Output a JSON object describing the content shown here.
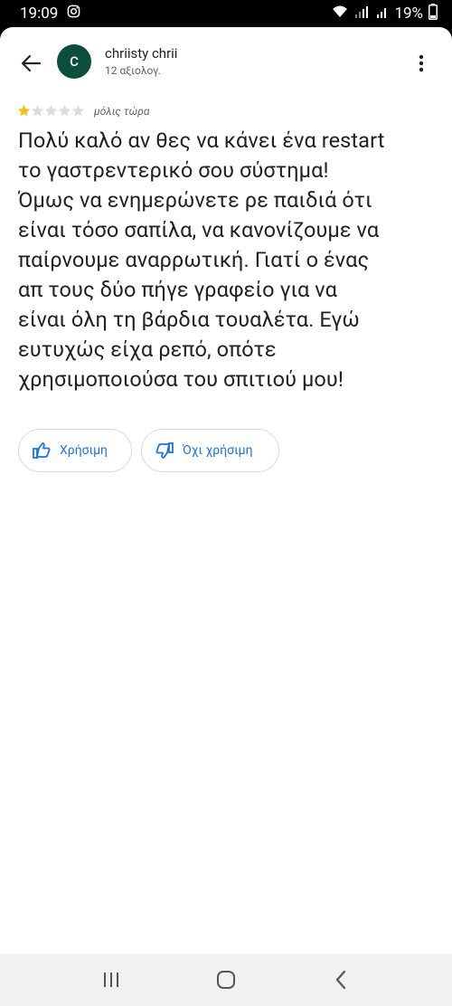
{
  "status_bar": {
    "time": "19:09",
    "battery": "19%"
  },
  "header": {
    "avatar_letter": "C",
    "user_name": "chriisty chrii",
    "user_meta": "12 αξιολογ."
  },
  "review": {
    "rating": 1,
    "max_rating": 5,
    "time": "μόλις τώρα",
    "text": "Πολύ καλό αν θες να κάνει ένα restart\nτο γαστρεντερικό σου σύστημα!\nΌμως να ενημερώνετε ρε παιδιά ότι\nείναι τόσο σαπίλα, να κανονίζουμε να\nπαίρνουμε αναρρωτική. Γιατί ο ένας\nαπ τους δύο πήγε γραφείο για να\nείναι όλη τη βάρδια τουαλέτα. Εγώ\nευτυχώς είχα ρεπό, οπότε\nχρησιμοποιούσα του σπιτιού μου!"
  },
  "actions": {
    "helpful_label": "Χρήσιμη",
    "not_helpful_label": "Όχι χρήσιμη"
  },
  "colors": {
    "accent": "#1a73e8",
    "avatar": "#0b4e3c",
    "star_filled": "#fbbc04",
    "star_empty": "#dadce0"
  }
}
